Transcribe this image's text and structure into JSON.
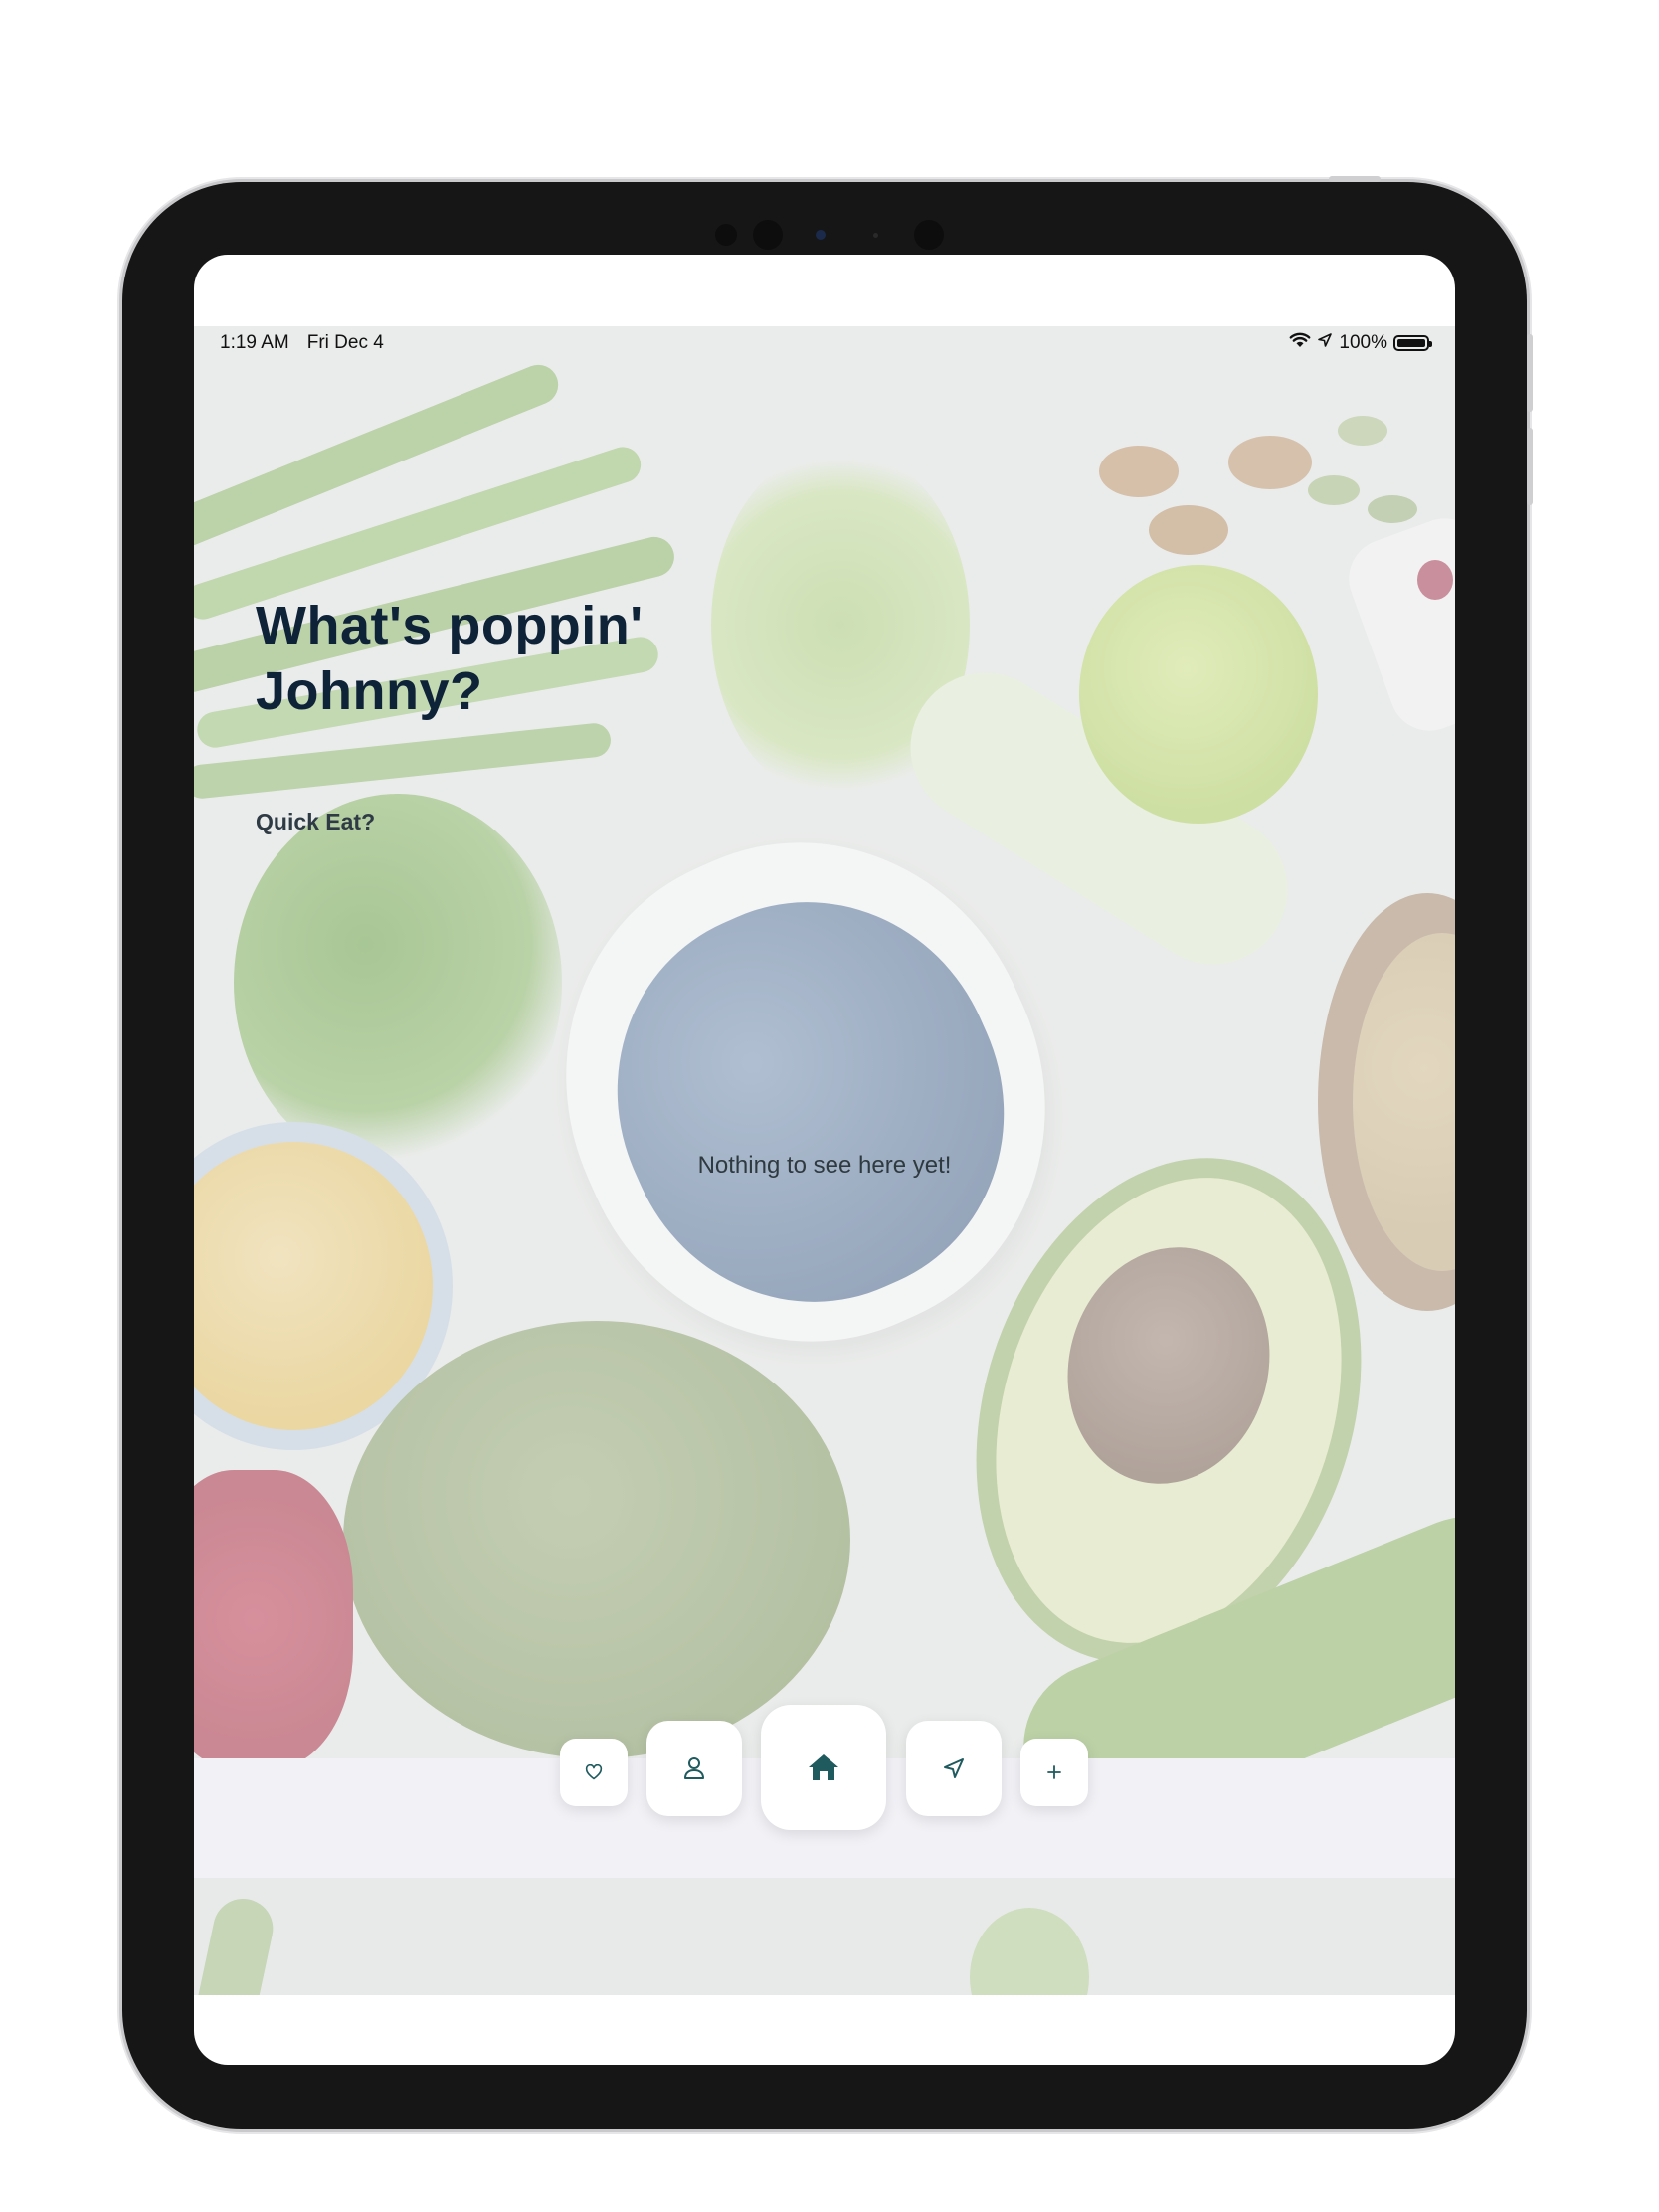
{
  "status_bar": {
    "time": "1:19 AM",
    "date": "Fri Dec 4",
    "battery": "100%",
    "icons": [
      "wifi-icon",
      "location-arrow-icon",
      "battery-icon"
    ]
  },
  "home": {
    "greeting_line1": "What's poppin'",
    "greeting_line2": "Johnny?",
    "section_title": "Quick Eat?",
    "empty_message": "Nothing to see here yet!"
  },
  "tab_bar": {
    "items": [
      {
        "icon": "heart-icon",
        "active": false
      },
      {
        "icon": "user-icon",
        "active": false
      },
      {
        "icon": "home-icon",
        "active": true
      },
      {
        "icon": "navigation-arrow-icon",
        "active": false
      },
      {
        "icon": "plus-icon",
        "active": false
      }
    ],
    "accent_color": "#1f5a5e"
  }
}
